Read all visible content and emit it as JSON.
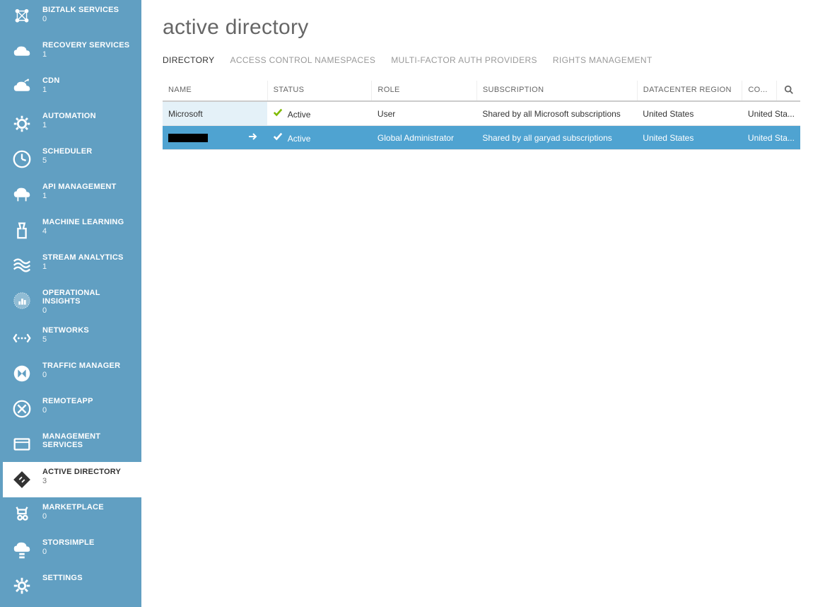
{
  "page_title": "active directory",
  "sidebar": [
    {
      "icon": "biztalk",
      "label": "BIZTALK SERVICES",
      "count": "0"
    },
    {
      "icon": "recovery",
      "label": "RECOVERY SERVICES",
      "count": "1"
    },
    {
      "icon": "cdn",
      "label": "CDN",
      "count": "1"
    },
    {
      "icon": "automation",
      "label": "AUTOMATION",
      "count": "1"
    },
    {
      "icon": "scheduler",
      "label": "SCHEDULER",
      "count": "5"
    },
    {
      "icon": "api",
      "label": "API MANAGEMENT",
      "count": "1"
    },
    {
      "icon": "ml",
      "label": "MACHINE LEARNING",
      "count": "4"
    },
    {
      "icon": "stream",
      "label": "STREAM ANALYTICS",
      "count": "1"
    },
    {
      "icon": "opins",
      "label": "OPERATIONAL INSIGHTS",
      "count": "0"
    },
    {
      "icon": "networks",
      "label": "NETWORKS",
      "count": "5"
    },
    {
      "icon": "traffic",
      "label": "TRAFFIC MANAGER",
      "count": "0"
    },
    {
      "icon": "remoteapp",
      "label": "REMOTEAPP",
      "count": "0"
    },
    {
      "icon": "mgmt",
      "label": "MANAGEMENT SERVICES",
      "count": ""
    },
    {
      "icon": "ad",
      "label": "ACTIVE DIRECTORY",
      "count": "3",
      "active": true
    },
    {
      "icon": "marketplace",
      "label": "MARKETPLACE",
      "count": "0"
    },
    {
      "icon": "storsimple",
      "label": "STORSIMPLE",
      "count": "0"
    },
    {
      "icon": "settings",
      "label": "SETTINGS",
      "count": ""
    }
  ],
  "tabs": [
    {
      "label": "DIRECTORY",
      "active": true
    },
    {
      "label": "ACCESS CONTROL NAMESPACES"
    },
    {
      "label": "MULTI-FACTOR AUTH PROVIDERS"
    },
    {
      "label": "RIGHTS MANAGEMENT"
    }
  ],
  "columns": {
    "name": "NAME",
    "status": "STATUS",
    "role": "ROLE",
    "subscription": "SUBSCRIPTION",
    "region": "DATACENTER REGION",
    "country": "CO..."
  },
  "rows": [
    {
      "name": "Microsoft",
      "status": "Active",
      "role": "User",
      "subscription": "Shared by all Microsoft subscriptions",
      "region": "United States",
      "country": "United Sta...",
      "highlighted": true
    },
    {
      "name": "",
      "redacted": true,
      "status": "Active",
      "role": "Global Administrator",
      "subscription": "Shared by all garyad subscriptions",
      "region": "United States",
      "country": "United Sta...",
      "selected": true
    }
  ]
}
